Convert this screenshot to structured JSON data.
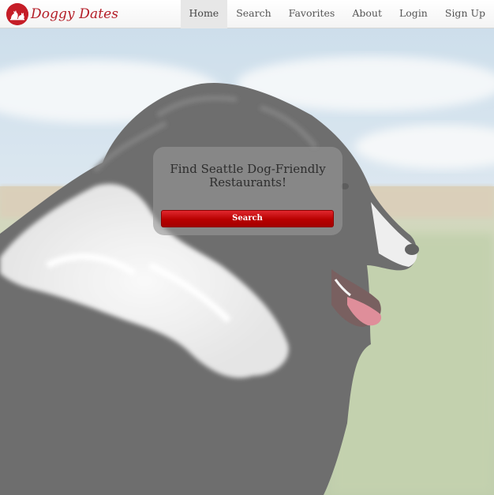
{
  "brand": {
    "name": "Doggy Dates",
    "logo_icon": "dog-logo-icon",
    "color": "#b41d27"
  },
  "nav": {
    "items": [
      {
        "label": "Home",
        "active": true
      },
      {
        "label": "Search",
        "active": false
      },
      {
        "label": "Favorites",
        "active": false
      },
      {
        "label": "About",
        "active": false
      },
      {
        "label": "Login",
        "active": false
      },
      {
        "label": "Sign Up",
        "active": false
      }
    ]
  },
  "hero": {
    "card_title": "Find Seattle Dog-Friendly Restaurants!",
    "search_button_label": "Search",
    "button_color": "#c00000"
  }
}
